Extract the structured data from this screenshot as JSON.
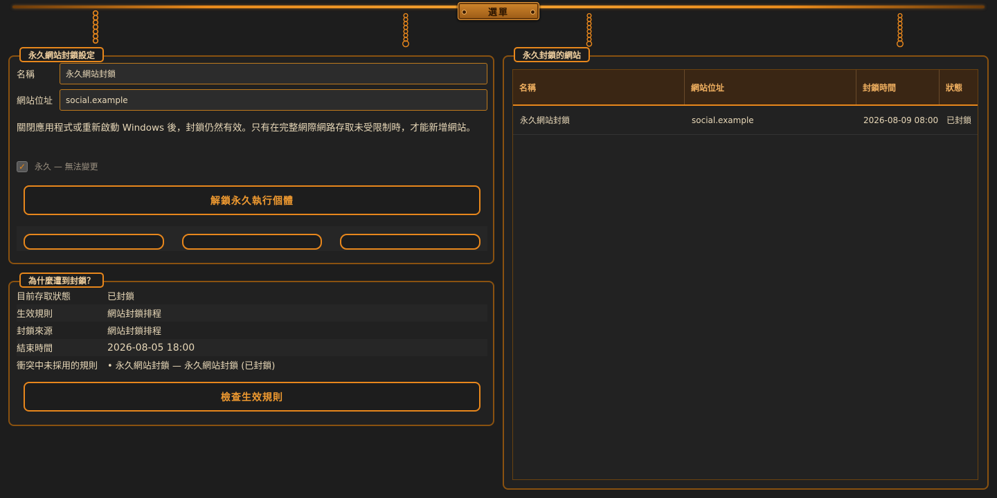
{
  "header": {
    "menu_label": "選單",
    "accent": "#e8871c"
  },
  "settings": {
    "title": "永久網站封鎖設定",
    "name_label": "名稱",
    "name_value": "永久網站封鎖",
    "url_label": "網站位址",
    "url_value": "social.example",
    "info": "關閉應用程式或重新啟動 Windows 後，封鎖仍然有效。只有在完整網際網路存取未受限制時，才能新增網站。",
    "permanent_label": "永久 — 無法變更",
    "permanent_checked": true,
    "unlock_button": "解鎖永久執行個體"
  },
  "why": {
    "title": "為什麼遭到封鎖？",
    "rows": [
      {
        "key": "目前存取狀態",
        "value": "已封鎖"
      },
      {
        "key": "生效規則",
        "value": "網站封鎖排程"
      },
      {
        "key": "封鎖來源",
        "value": "網站封鎖排程"
      },
      {
        "key": "結束時間",
        "value": "2026-08-05 18:00"
      },
      {
        "key": "衝突中未採用的規則",
        "value": "• 永久網站封鎖 — 永久網站封鎖 (已封鎖)"
      }
    ],
    "check_button": "檢查生效規則"
  },
  "blocked_sites": {
    "title": "永久封鎖的網站",
    "columns": [
      "名稱",
      "網站位址",
      "封鎖時間",
      "狀態"
    ],
    "rows": [
      {
        "name": "永久網站封鎖",
        "url": "social.example",
        "time": "2026-08-09 08:00",
        "status": "已封鎖"
      }
    ]
  }
}
